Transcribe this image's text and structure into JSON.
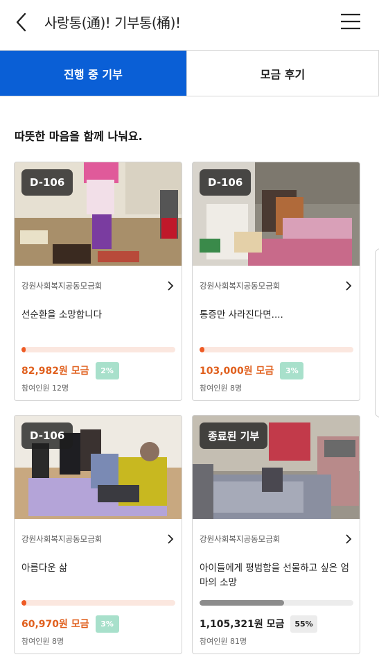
{
  "header": {
    "title": "사랑통(通)! 기부통(桶)!"
  },
  "tabs": [
    {
      "label": "진행 중 기부",
      "active": true
    },
    {
      "label": "모금 후기",
      "active": false
    }
  ],
  "section": {
    "title": "따뜻한 마음을 함께 나눠요."
  },
  "colors": {
    "accent": "#0a5fd6",
    "amount": "#e0601e",
    "progress": "#ee5a24",
    "percent_badge": "#a8e0cb"
  },
  "cards": [
    {
      "badge": "D-106",
      "org": "강원사회복지공동모금회",
      "title": "선순환을 소망합니다",
      "amount": "82,982원 모금",
      "percent": "2%",
      "progress": 0.02,
      "participants": "참여인원 12명",
      "status": "ongoing"
    },
    {
      "badge": "D-106",
      "org": "강원사회복지공동모금회",
      "title": "통증만 사라진다면....",
      "amount": "103,000원 모금",
      "percent": "3%",
      "progress": 0.03,
      "participants": "참여인원 8명",
      "status": "ongoing"
    },
    {
      "badge": "D-106",
      "org": "강원사회복지공동모금회",
      "title": "아름다운 삶",
      "amount": "60,970원 모금",
      "percent": "3%",
      "progress": 0.03,
      "participants": "참여인원 8명",
      "status": "ongoing"
    },
    {
      "badge": "종료된 기부",
      "org": "강원사회복지공동모금회",
      "title": "아이들에게 평범함을 선물하고 싶은 엄마의 소망",
      "amount": "1,105,321원 모금",
      "percent": "55%",
      "progress": 0.55,
      "participants": "참여인원 81명",
      "status": "ended"
    }
  ]
}
